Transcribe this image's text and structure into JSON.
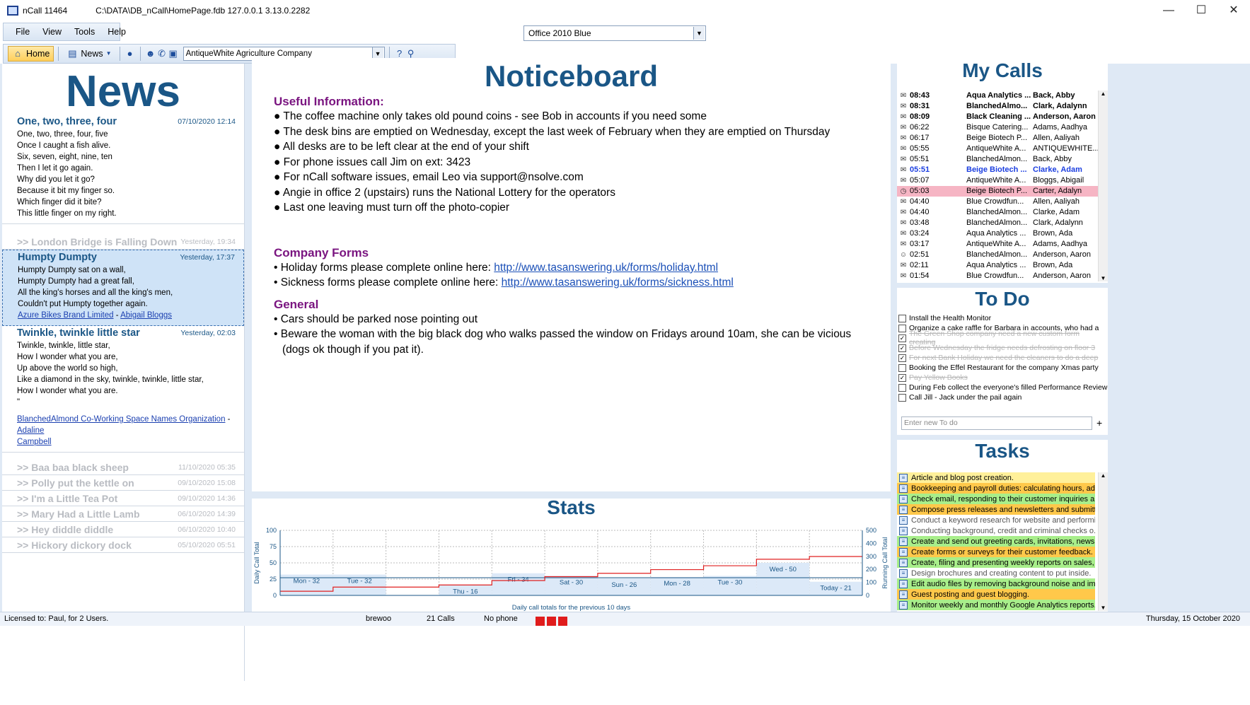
{
  "window": {
    "app_title": "nCall 11464",
    "path": "C:\\DATA\\DB_nCall\\HomePage.fdb 127.0.0.1 3.13.0.2282",
    "minimize": "—",
    "maximize": "☐",
    "close": "✕"
  },
  "menu": [
    "File",
    "View",
    "Tools",
    "Help"
  ],
  "theme": {
    "selected": "Office 2010 Blue"
  },
  "toolbar": {
    "home_label": "Home",
    "news_label": "News",
    "company_selected": "AntiqueWhite Agriculture Company"
  },
  "news": {
    "heading": "News",
    "items": [
      {
        "title": "One, two, three, four",
        "date": "07/10/2020 12:14",
        "lines": [
          "One, two, three, four, five",
          "Once I caught a fish alive.",
          "Six, seven, eight, nine, ten",
          "Then I let it go again.",
          "Why did you let it go?",
          "Because it bit my finger so.",
          "Which finger did it bite?",
          "This little finger on my right."
        ]
      }
    ],
    "collapsed1": {
      "title": ">> London Bridge is Falling Down",
      "date": "Yesterday, 19:34"
    },
    "selected": {
      "title": "Humpty Dumpty",
      "date": "Yesterday, 17:37",
      "lines": [
        "Humpty Dumpty sat on a wall,",
        "Humpty Dumpty had a great fall,",
        "All the king's horses and all the king's men,",
        "Couldn't put Humpty together again."
      ],
      "link1": "Azure Bikes Brand Limited",
      "sep": " - ",
      "link2": "Abigail Bloggs"
    },
    "twinkle": {
      "title": "Twinkle, twinkle little star",
      "date": "Yesterday, 02:03",
      "lines": [
        "Twinkle, twinkle, little star,",
        "How I wonder what you are,",
        "Up above the world so high,",
        "Like a diamond in the sky, twinkle, twinkle, little star,",
        "How I wonder what you are.",
        "\""
      ],
      "link1": "BlanchedAlmond Co-Working Space Names Organization",
      "sep": " - ",
      "link2a": "Adaline",
      "link2b": "Campbell"
    },
    "collapsed": [
      {
        "title": ">> Baa baa black sheep",
        "date": "11/10/2020 05:35"
      },
      {
        "title": ">> Polly put the kettle on",
        "date": "09/10/2020 15:08"
      },
      {
        "title": ">> I'm a Little Tea Pot",
        "date": "09/10/2020 14:36"
      },
      {
        "title": ">> Mary Had a Little Lamb",
        "date": "06/10/2020 14:39"
      },
      {
        "title": ">> Hey diddle diddle",
        "date": "06/10/2020 10:40"
      },
      {
        "title": ">> Hickory dickory dock",
        "date": "05/10/2020 05:51"
      }
    ]
  },
  "noticeboard": {
    "title": "Noticeboard",
    "useful_heading": "Useful Information:",
    "useful": [
      "The coffee machine only takes old pound coins - see Bob in accounts if you need some",
      "The desk bins are emptied on Wednesday, except the last week of February when they are emptied on Thursday",
      "All desks are to be left clear at the end of your shift",
      "For phone issues call Jim on ext: 3423",
      "For nCall software issues, email Leo via support@nsolve.com",
      "Angie in office 2 (upstairs) runs the National Lottery for the operators",
      "Last one leaving must turn off the photo-copier"
    ],
    "forms_heading": "Company Forms",
    "forms": [
      {
        "text": "Holiday forms please complete online here: ",
        "link": "http://www.tasanswering.uk/forms/holiday.html"
      },
      {
        "text": "Sickness forms please complete online here: ",
        "link": "http://www.tasanswering.uk/forms/sickness.html"
      }
    ],
    "general_heading": "General",
    "general": [
      "Cars should be parked nose pointing out",
      "Beware the woman with the big black dog who walks passed the window on Fridays around 10am, she can be vicious (dogs ok though if you pat it)."
    ]
  },
  "stats": {
    "title": "Stats"
  },
  "chart_data": {
    "type": "bar",
    "title": "Stats",
    "categories": [
      "Mon",
      "Tue",
      "Wed",
      "Thu",
      "Fri",
      "Sat",
      "Sun",
      "Mon",
      "Tue",
      "Wed",
      "Today"
    ],
    "values": [
      32,
      32,
      0,
      16,
      34,
      30,
      26,
      28,
      30,
      50,
      21
    ],
    "bar_labels": [
      "Mon - 32",
      "Tue - 32",
      "",
      "Thu - 16",
      "Fri - 34",
      "Sat - 30",
      "Sun - 26",
      "Mon - 28",
      "Tue - 30",
      "Wed - 50",
      "Today - 21"
    ],
    "running_total": [
      32,
      64,
      64,
      80,
      114,
      144,
      170,
      198,
      228,
      278,
      299
    ],
    "ylabel": "Daily Call Total",
    "y2label": "Running Call Total",
    "xlabel": "Daily call totals for the previous 10 days",
    "ylim": [
      0,
      100
    ],
    "y2lim": [
      0,
      500
    ],
    "yticks": [
      "100",
      "75",
      "50",
      "25",
      "0"
    ],
    "y2ticks": [
      "500",
      "400",
      "300",
      "200",
      "100",
      "0"
    ],
    "colors": {
      "bars": "#dce9f8",
      "line": "#e02020",
      "avg": "#1a5686"
    }
  },
  "mycalls": {
    "title": "My Calls",
    "rows": [
      {
        "icon": "mail",
        "time": "08:43",
        "company": "Aqua Analytics ...",
        "name": "Back, Abby",
        "style": "bold"
      },
      {
        "icon": "mail",
        "time": "08:31",
        "company": "BlanchedAlmo...",
        "name": "Clark, Adalynn",
        "style": "bold"
      },
      {
        "icon": "mail",
        "time": "08:09",
        "company": "Black Cleaning ...",
        "name": "Anderson, Aaron",
        "style": "bold"
      },
      {
        "icon": "open",
        "time": "06:22",
        "company": "Bisque Catering...",
        "name": "Adams, Aadhya",
        "style": ""
      },
      {
        "icon": "open",
        "time": "06:17",
        "company": "Beige Biotech P...",
        "name": "Allen, Aaliyah",
        "style": ""
      },
      {
        "icon": "open",
        "time": "05:55",
        "company": "AntiqueWhite A...",
        "name": "ANTIQUEWHITE...",
        "style": ""
      },
      {
        "icon": "open",
        "time": "05:51",
        "company": "BlanchedAlmon...",
        "name": "Back, Abby",
        "style": ""
      },
      {
        "icon": "mail",
        "time": "05:51",
        "company": "Beige Biotech ...",
        "name": "Clarke, Adam",
        "style": "bluebold"
      },
      {
        "icon": "open",
        "time": "05:07",
        "company": "AntiqueWhite A...",
        "name": "Bloggs, Abigail",
        "style": ""
      },
      {
        "icon": "clock",
        "time": "05:03",
        "company": "Beige Biotech P...",
        "name": "Carter, Adalyn",
        "style": "pink"
      },
      {
        "icon": "open",
        "time": "04:40",
        "company": "Blue Crowdfun...",
        "name": "Allen, Aaliyah",
        "style": ""
      },
      {
        "icon": "open",
        "time": "04:40",
        "company": "BlanchedAlmon...",
        "name": "Clarke, Adam",
        "style": ""
      },
      {
        "icon": "open",
        "time": "03:48",
        "company": "BlanchedAlmon...",
        "name": "Clark, Adalynn",
        "style": ""
      },
      {
        "icon": "open",
        "time": "03:24",
        "company": "Aqua Analytics ...",
        "name": "Brown, Ada",
        "style": ""
      },
      {
        "icon": "open",
        "time": "03:17",
        "company": "AntiqueWhite A...",
        "name": "Adams, Aadhya",
        "style": ""
      },
      {
        "icon": "person",
        "time": "02:51",
        "company": "BlanchedAlmon...",
        "name": "Anderson, Aaron",
        "style": ""
      },
      {
        "icon": "open",
        "time": "02:11",
        "company": "Aqua Analytics ...",
        "name": "Brown, Ada",
        "style": ""
      },
      {
        "icon": "open",
        "time": "01:54",
        "company": "Blue Crowdfun...",
        "name": "Anderson, Aaron",
        "style": ""
      }
    ]
  },
  "todo": {
    "title": "To Do",
    "items": [
      {
        "text": "Install the Health Monitor",
        "done": false
      },
      {
        "text": "Organize a cake raffle for Barbara in accounts, who had a",
        "done": false
      },
      {
        "text": "The Green Shop company need a new custom form creating",
        "done": true
      },
      {
        "text": "Before Wednesday the fridge needs defrosting on floor 3",
        "done": true
      },
      {
        "text": "For next Bank Holiday we need the cleaners to do a deep",
        "done": true
      },
      {
        "text": "Booking the Effel Restaurant for the company Xmas party",
        "done": false
      },
      {
        "text": "Pay Yellow Books",
        "done": true
      },
      {
        "text": "During Feb collect the everyone's filled Performance Review",
        "done": false
      },
      {
        "text": "Call Jill - Jack under the pail again",
        "done": false
      }
    ],
    "placeholder": "Enter new To do",
    "add": "+"
  },
  "tasks": {
    "title": "Tasks",
    "items": [
      {
        "text": "Article and blog post creation.",
        "color": "y"
      },
      {
        "text": "Bookkeeping and payroll duties: calculating hours, ad...",
        "color": "o"
      },
      {
        "text": "Check email, responding to their customer inquiries a...",
        "color": "g"
      },
      {
        "text": "Compose press releases and newsletters and submittin...",
        "color": "o"
      },
      {
        "text": "Conduct a keyword research for website and performi...",
        "color": "w"
      },
      {
        "text": "Conducting background, credit and criminal checks o...",
        "color": "w"
      },
      {
        "text": "Create and send out greeting cards, invitations, newsle...",
        "color": "g"
      },
      {
        "text": "Create forms or surveys for their customer feedback.",
        "color": "o"
      },
      {
        "text": "Create, filing and presenting weekly reports on sales, d...",
        "color": "g"
      },
      {
        "text": "Design brochures and creating content to put inside.",
        "color": "w"
      },
      {
        "text": "Edit audio files by removing background noise and im...",
        "color": "g"
      },
      {
        "text": "Guest posting and guest blogging.",
        "color": "o"
      },
      {
        "text": "Monitor weekly and monthly Google Analytics reports...",
        "color": "g"
      }
    ]
  },
  "status": {
    "license": "Licensed to: Paul, for 2 Users.",
    "user": "brewoo",
    "calls": "21 Calls",
    "phone": "No phone",
    "date": "Thursday, 15 October 2020"
  }
}
